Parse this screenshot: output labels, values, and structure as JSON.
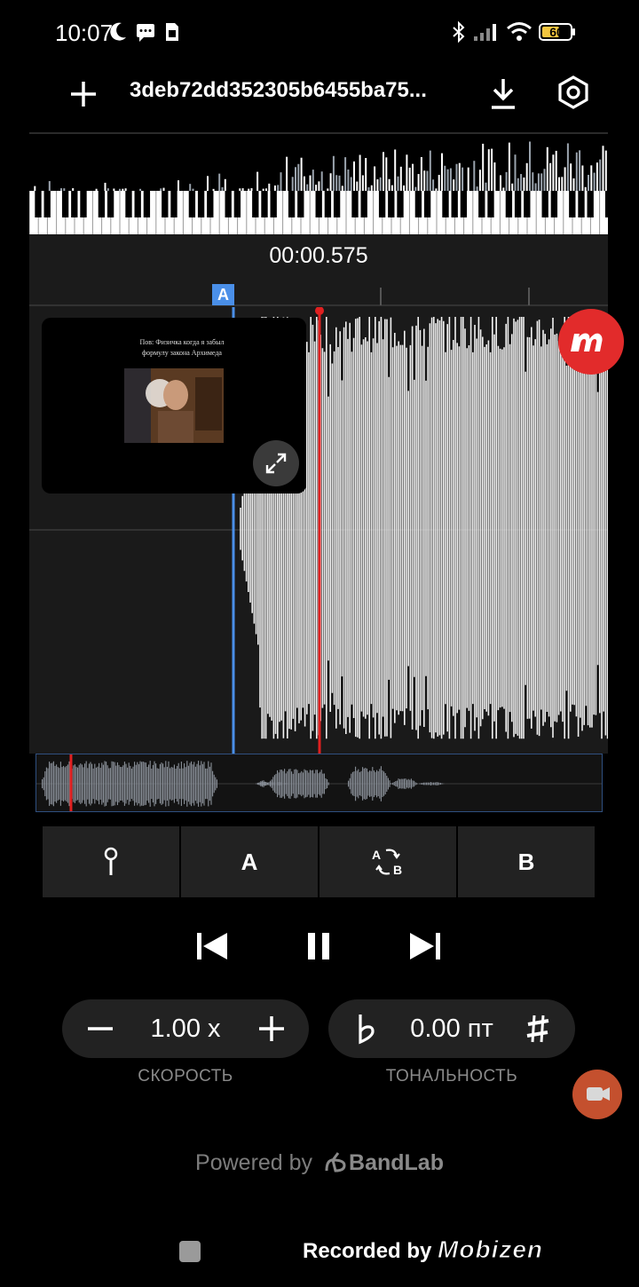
{
  "status_bar": {
    "time": "10:07",
    "battery": "60"
  },
  "app_bar": {
    "title": "3deb72dd352305b6455ba75..."
  },
  "player": {
    "position": "00:00.575",
    "marker_a_label": "A",
    "playhead_fraction": 0.061
  },
  "video": {
    "caption": "Пов: Физичка когда я забыл формулу закона Архимеда"
  },
  "ab_controls": {
    "a_label": "A",
    "b_label": "B"
  },
  "speed": {
    "value": "1.00 x",
    "label": "СКОРОСТЬ"
  },
  "pitch": {
    "value": "0.00 пт",
    "label": "ТОНАЛЬНОСТЬ"
  },
  "footer": {
    "powered_prefix": "Powered by",
    "powered_brand": "BandLab",
    "recorded_prefix": "Recorded by",
    "recorded_brand": "Mobizen"
  },
  "colors": {
    "accent_blue": "#4a8fe8",
    "playhead_red": "#e02020",
    "mobizen_red": "#e22b2b"
  }
}
